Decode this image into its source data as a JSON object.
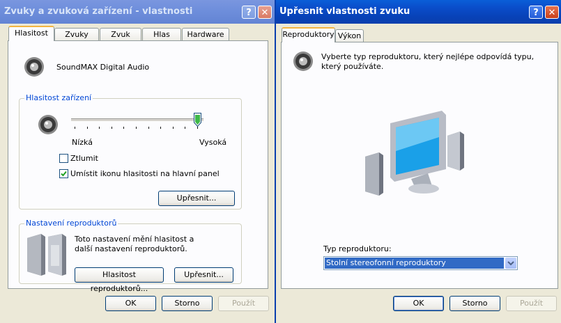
{
  "left": {
    "title": "Zvuky a zvuková zařízení - vlastnosti",
    "help_btn": "?",
    "close_btn": "✕",
    "tabs": [
      {
        "label": "Hlasitost",
        "active": true
      },
      {
        "label": "Zvuky",
        "active": false
      },
      {
        "label": "Zvuk",
        "active": false
      },
      {
        "label": "Hlas",
        "active": false
      },
      {
        "label": "Hardware",
        "active": false
      }
    ],
    "device_name": "SoundMAX Digital Audio",
    "device_volume": {
      "group_title": "Hlasitost zařízení",
      "low_label": "Nízká",
      "high_label": "Vysoká",
      "slider_level": 1.0,
      "mute_label": "Ztlumit",
      "mute_checked": false,
      "tray_icon_label": "Umístit ikonu hlasitosti na hlavní panel",
      "tray_icon_checked": true,
      "advanced_btn": "Upřesnit..."
    },
    "speaker_settings": {
      "group_title": "Nastavení reproduktorů",
      "description": "Toto nastavení mění hlasitost a další nastavení reproduktorů.",
      "volume_btn": "Hlasitost reproduktorů...",
      "advanced_btn": "Upřesnit..."
    },
    "footer": {
      "ok": "OK",
      "cancel": "Storno",
      "apply": "Použít"
    }
  },
  "right": {
    "title": "Upřesnit vlastnosti zvuku",
    "help_btn": "?",
    "close_btn": "✕",
    "tabs": [
      {
        "label": "Reproduktory",
        "active": true
      },
      {
        "label": "Výkon",
        "active": false
      }
    ],
    "description": "Vyberte typ reproduktoru, který nejlépe odpovídá typu, který používáte.",
    "speaker_type_label": "Typ reproduktoru:",
    "speaker_type_value": "Stolní stereofonní reproduktory",
    "footer": {
      "ok": "OK",
      "cancel": "Storno",
      "apply": "Použít"
    }
  },
  "colors": {
    "accent": "#0046d5",
    "titlebar": "#0a4ecb",
    "selection": "#316ac5"
  }
}
